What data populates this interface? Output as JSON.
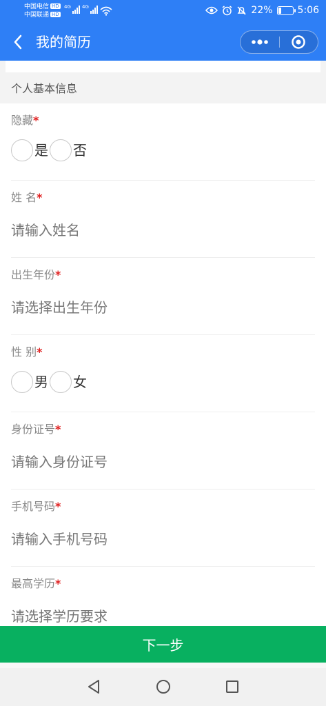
{
  "status_bar": {
    "carrier1": "中国电信",
    "carrier2": "中国联通",
    "hd": "HD",
    "network": "4G",
    "battery_percent": "22%",
    "battery_level": 0.22,
    "time": "5:06",
    "icons": [
      "eye-icon",
      "alarm-icon",
      "mute-icon",
      "battery-icon",
      "wifi-icon",
      "signal-icon"
    ]
  },
  "nav": {
    "title": "我的简历",
    "back_icon": "chevron-left-icon",
    "more_icon": "more-dots-icon",
    "close_icon": "target-circle-icon"
  },
  "section": {
    "title": "个人基本信息"
  },
  "fields": {
    "hidden": {
      "label": "隐藏",
      "required": "*",
      "options": [
        "是",
        "否"
      ]
    },
    "name": {
      "label": "姓 名",
      "required": "*",
      "placeholder": "请输入姓名"
    },
    "birth_year": {
      "label": "出生年份",
      "required": "*",
      "placeholder": "请选择出生年份"
    },
    "gender": {
      "label": "性 别",
      "required": "*",
      "options": [
        "男",
        "女"
      ]
    },
    "id_number": {
      "label": "身份证号",
      "required": "*",
      "placeholder": "请输入身份证号"
    },
    "phone": {
      "label": "手机号码",
      "required": "*",
      "placeholder": "请输入手机号码"
    },
    "education": {
      "label": "最高学历",
      "required": "*",
      "placeholder": "请选择学历要求"
    }
  },
  "footer": {
    "next_label": "下一步"
  },
  "colors": {
    "header": "#2e7ff6",
    "primary_button": "#08b060",
    "required": "#e02020"
  }
}
